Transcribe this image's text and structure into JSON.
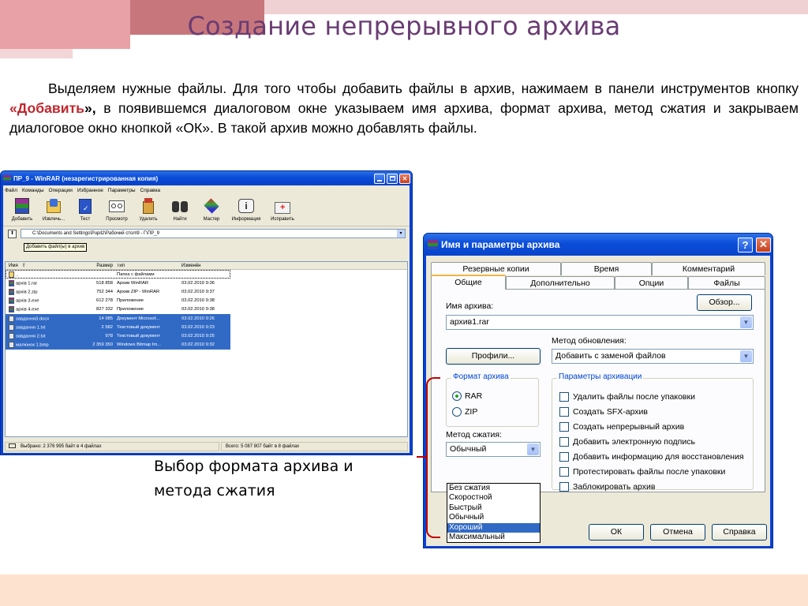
{
  "slide": {
    "title": "Создание непрерывного архива",
    "intro_part1": "Выделяем нужные файлы. Для того чтобы добавить файлы в архив, нажимаем в панели инструментов кнопку ",
    "intro_highlight": "«Добавить",
    "intro_bold_tail": "»,",
    "intro_part2": " в появившемся диалоговом окне указываем имя архива, формат архива, метод сжатия и закрываем диалоговое окно кнопкой «ОК». В такой архив можно добавлять файлы.",
    "caption_line1": "Выбор формата архива и",
    "caption_line2": "метода сжатия",
    "colors": {
      "title": "#6a3c73",
      "highlight": "#c0272d",
      "bracket": "#c00000"
    }
  },
  "winrar": {
    "title": "ПР_9 - WinRAR (незарегистрированная копия)",
    "menu": [
      "Файл",
      "Команды",
      "Операции",
      "Избранное",
      "Параметры",
      "Справка"
    ],
    "tools": [
      {
        "label": "Добавить",
        "icon": "add-archive-icon"
      },
      {
        "label": "Извлечь...",
        "icon": "extract-icon"
      },
      {
        "label": "Тест",
        "icon": "test-icon"
      },
      {
        "label": "Просмотр",
        "icon": "view-icon"
      },
      {
        "label": "Удалить",
        "icon": "delete-icon"
      },
      {
        "label": "Найти",
        "icon": "find-icon"
      },
      {
        "label": "Мастер",
        "icon": "wizard-icon"
      },
      {
        "label": "Информация",
        "icon": "info-icon"
      },
      {
        "label": "Исправить",
        "icon": "repair-icon"
      }
    ],
    "tooltip": "Добавить файл(ы) в архив",
    "address": "C:\\Documents and Settings\\Pupil2\\Рабочий стол\\9 - Г\\ПР_9",
    "columns": {
      "name": "Имя",
      "size": "Размер",
      "type": "Тип",
      "modified": "Изменён"
    },
    "rows": [
      {
        "name": "..",
        "size": "",
        "type": "Папка с файлами",
        "date": "",
        "sel": false
      },
      {
        "name": "архів 1.rar",
        "size": "518 858",
        "type": "Архив WinRAR",
        "date": "03.02.2010 9:36",
        "sel": false
      },
      {
        "name": "архів 2.zip",
        "size": "752 344",
        "type": "Архив ZIP - WinRAR",
        "date": "03.02.2010 9:37",
        "sel": false
      },
      {
        "name": "архів 3.exe",
        "size": "612 278",
        "type": "Приложение",
        "date": "03.02.2010 9:38",
        "sel": false
      },
      {
        "name": "архів 4.exe",
        "size": "827 332",
        "type": "Приложение",
        "date": "03.02.2010 9:38",
        "sel": false
      },
      {
        "name": "завдання3.docx",
        "size": "14 085",
        "type": "Документ Microsof...",
        "date": "03.02.2010 9:26",
        "sel": true
      },
      {
        "name": "завдання 1.txt",
        "size": "2 582",
        "type": "Текстовый документ",
        "date": "03.02.2010 9:23",
        "sel": true
      },
      {
        "name": "завдання 2.txt",
        "size": "978",
        "type": "Текстовый документ",
        "date": "03.02.2010 9:25",
        "sel": true
      },
      {
        "name": "малюнок 1.bmp",
        "size": "2 359 350",
        "type": "Windows Bitmap Im...",
        "date": "03.02.2010 9:32",
        "sel": true
      }
    ],
    "status_left": "Выбрано: 2 376 995 байт в 4 файлах",
    "status_right": "Всего: 5 087 807 байт в 8 файлах"
  },
  "dialog": {
    "title": "Имя и параметры архива",
    "tabs_row1": [
      "Резервные копии",
      "Время",
      "Комментарий"
    ],
    "tabs_row2": [
      "Общие",
      "Дополнительно",
      "Опции",
      "Файлы"
    ],
    "archive_name_label": "Имя архива:",
    "archive_name": "архив1.rar",
    "browse": "Обзор...",
    "profiles": "Профили...",
    "update_label": "Метод обновления:",
    "update_value": "Добавить с заменой файлов",
    "format_group": "Формат архива",
    "format_rar": "RAR",
    "format_zip": "ZIP",
    "method_label": "Метод сжатия:",
    "method_value": "Обычный",
    "methods": [
      "Без сжатия",
      "Скоростной",
      "Быстрый",
      "Обычный",
      "Хороший",
      "Максимальный"
    ],
    "method_highlighted": "Хороший",
    "options_group": "Параметры архивации",
    "options": [
      "Удалить файлы после упаковки",
      "Создать SFX-архив",
      "Создать непрерывный архив",
      "Добавить электронную подпись",
      "Добавить информацию для восстановления",
      "Протестировать файлы после упаковки",
      "Заблокировать архив"
    ],
    "ok": "ОК",
    "cancel": "Отмена",
    "help": "Справка"
  }
}
